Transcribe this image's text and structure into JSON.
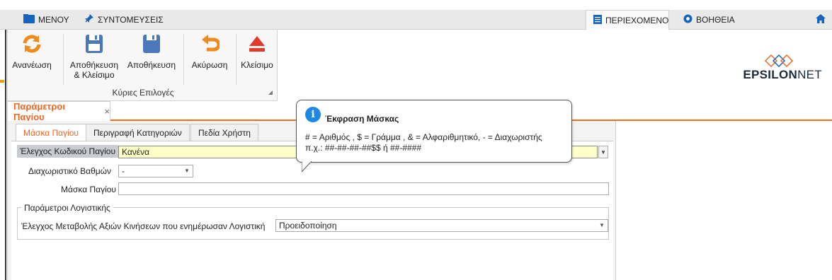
{
  "menubar": {
    "menu_label": "ΜΕΝΟΥ",
    "shortcuts_label": "ΣΥΝΤΟΜΕΥΣΕΙΣ",
    "content_tab_label": "ΠΕΡΙΕΧΟΜΕΝΟ",
    "help_tab_label": "ΒΟΗΘΕΙΑ",
    "menu_icon": "folder-icon",
    "shortcuts_icon": "pin-icon",
    "content_icon": "document-icon",
    "help_icon": "help-icon",
    "home_icon": "home-icon"
  },
  "ribbon": {
    "buttons": [
      {
        "label_line1": "Ανανέωση",
        "label_line2": "",
        "icon": "refresh-icon"
      },
      {
        "label_line1": "Αποθήκευση",
        "label_line2": "& Κλείσιμο",
        "icon": "save-close-icon"
      },
      {
        "label_line1": "Αποθήκευση",
        "label_line2": "",
        "icon": "save-icon"
      },
      {
        "label_line1": "Ακύρωση",
        "label_line2": "",
        "icon": "undo-icon"
      },
      {
        "label_line1": "Κλείσιμο",
        "label_line2": "",
        "icon": "eject-icon"
      }
    ],
    "group_label": "Κύριες Επιλογές"
  },
  "logo": {
    "bold": "EPSILON",
    "light": "NET"
  },
  "document_tab": {
    "title": "Παράμετροι Παγίου",
    "close": "×"
  },
  "sub_tabs": [
    "Μάσκα Παγίου",
    "Περιγραφή Κατηγοριών",
    "Πεδία Χρήστη"
  ],
  "form": {
    "code_check_label": "Έλεγχος Κωδικού Παγίου",
    "code_check_value": "Κανένα",
    "separator_label": "Διαχωριστικό Βαθμών",
    "separator_value": "-",
    "mask_label": "Μάσκα Παγίου",
    "mask_value": "",
    "accounting_group_title": "Παράμετροι Λογιστικής",
    "value_change_label": "Έλεγχος Μεταβολής Αξιών Κινήσεων που ενημέρωσαν Λογιστική",
    "value_change_value": "Προειδοποίηση"
  },
  "tooltip": {
    "icon": "info-icon",
    "icon_glyph": "i",
    "title": "Έκφραση Μάσκας",
    "line1": "# = Αριθμός , $ = Γράμμα , & = Αλφαριθμητικό, - = Διαχωριστής",
    "line2": "π.χ.: ##-##-##-##$$ ή ##-####"
  },
  "colors": {
    "accent": "#f26522",
    "info_blue": "#1e88e5",
    "required_field": "#ffffc8"
  }
}
